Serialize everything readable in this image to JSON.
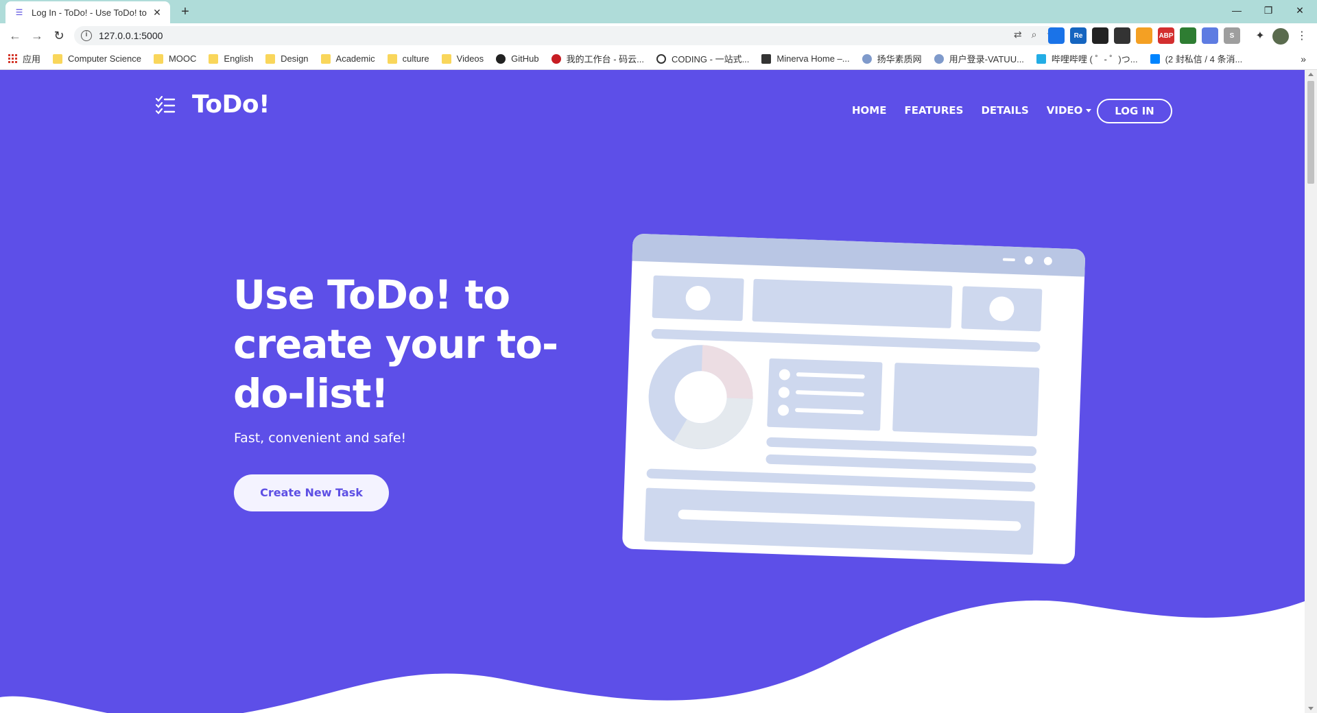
{
  "browser": {
    "tab_title": "Log In - ToDo! - Use ToDo! to",
    "tab_close": "✕",
    "new_tab": "+",
    "url": "127.0.0.1:5000",
    "window_controls": [
      "—",
      "❐",
      "✕"
    ],
    "extensions": [
      {
        "name": "translate-icon",
        "label": "",
        "color": "#1a73e8"
      },
      {
        "name": "re-extension-icon",
        "label": "Re",
        "color": "#1565c0"
      },
      {
        "name": "tampermonkey-icon",
        "label": "",
        "color": "#222222"
      },
      {
        "name": "glasses-extension-icon",
        "label": "",
        "color": "#333333"
      },
      {
        "name": "rss-extension-icon",
        "label": "",
        "color": "#f4a023"
      },
      {
        "name": "adblock-icon",
        "label": "ABP",
        "color": "#d32f2f"
      },
      {
        "name": "globe-extension-icon",
        "label": "",
        "color": "#2e7d32"
      },
      {
        "name": "feather-extension-icon",
        "label": "",
        "color": "#5e7ce2"
      },
      {
        "name": "s-extension-icon",
        "label": "S",
        "color": "#9e9e9e"
      }
    ]
  },
  "bookmarks": {
    "apps_label": "应用",
    "items": [
      {
        "label": "Computer Science",
        "type": "folder"
      },
      {
        "label": "MOOC",
        "type": "folder"
      },
      {
        "label": "English",
        "type": "folder"
      },
      {
        "label": "Design",
        "type": "folder"
      },
      {
        "label": "Academic",
        "type": "folder"
      },
      {
        "label": "culture",
        "type": "folder"
      },
      {
        "label": "Videos",
        "type": "folder"
      },
      {
        "label": "GitHub",
        "type": "github"
      },
      {
        "label": "我的工作台 - 码云...",
        "type": "gitee"
      },
      {
        "label": "CODING - 一站式...",
        "type": "coding"
      },
      {
        "label": "Minerva Home –...",
        "type": "bb"
      },
      {
        "label": "扬华素质网",
        "type": "site"
      },
      {
        "label": "用户登录-VATUU...",
        "type": "site"
      },
      {
        "label": "哔哩哔哩 ( ゜- ゜)つ...",
        "type": "bili"
      },
      {
        "label": "(2 封私信 / 4 条消...",
        "type": "zhihu"
      }
    ],
    "more": "»"
  },
  "site": {
    "brand": "ToDo!",
    "nav": {
      "home": "HOME",
      "features": "FEATURES",
      "details": "DETAILS",
      "video": "VIDEO",
      "login": "LOG IN"
    },
    "hero": {
      "title": "Use ToDo! to create your to-do-list!",
      "subtitle": "Fast, convenient and safe!",
      "cta": "Create New Task"
    },
    "colors": {
      "primary": "#5d4fe8",
      "cta_bg": "#f4f3ff",
      "illustration_frame": "#ffffff",
      "illustration_block": "#ced8ee"
    }
  }
}
